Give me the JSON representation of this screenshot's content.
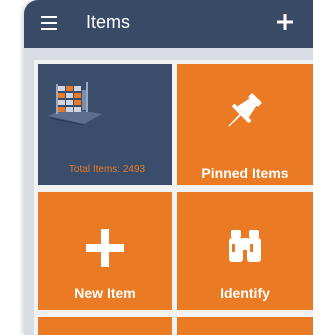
{
  "appbar": {
    "title": "Items",
    "menu_icon": "hamburger-menu-icon",
    "add_icon": "plus-icon"
  },
  "tiles": [
    {
      "label": "Total Items: 2493",
      "icon": "warehouse-shelves-icon"
    },
    {
      "label": "Pinned Items",
      "icon": "pushpin-icon"
    },
    {
      "label": "New Item",
      "icon": "plus-icon"
    },
    {
      "label": "Identify",
      "icon": "binoculars-icon"
    }
  ],
  "colors": {
    "appbar": "#394a66",
    "tile_dark": "#3a4d6b",
    "tile_orange": "#ea7b24",
    "background": "#f2f2f2"
  }
}
